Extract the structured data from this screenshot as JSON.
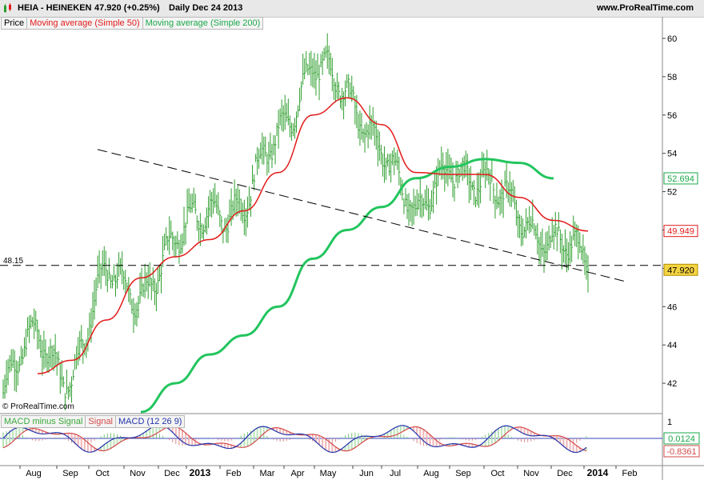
{
  "header": {
    "symbol": "HEIA - HEINEKEN",
    "last": "47.920 (+0.25%)",
    "period": "Daily  Dec 24 2013",
    "site": "www.ProRealTime.com"
  },
  "legend": {
    "price": "Price",
    "sma50": "Moving average (Simple 50)",
    "sma200": "Moving average (Simple 200)"
  },
  "macd_legend": {
    "hist": "MACD minus Signal",
    "signal": "Signal",
    "macd": "MACD (12 26 9)"
  },
  "copyright": "© ProRealTime.com",
  "colors": {
    "price_bars": "#2e9e2e",
    "sma50": "#e31a1a",
    "sma200": "#22c55e",
    "macd": "#2233aa",
    "signal": "#d44a4a",
    "hist": "#8ec98e",
    "label_last": "#f5d442",
    "grid": "#c8c8c8"
  },
  "chart_data": {
    "type": "line",
    "y_ticks": [
      42,
      44,
      46,
      48,
      50,
      52,
      54,
      56,
      58,
      60
    ],
    "ylim": [
      40.5,
      60.5
    ],
    "x_ticks": [
      "Aug",
      "Sep",
      "Oct",
      "Nov",
      "Dec",
      "2013",
      "Feb",
      "Mar",
      "Apr",
      "May",
      "Jun",
      "Jul",
      "Aug",
      "Sep",
      "Oct",
      "Nov",
      "Dec",
      "2014",
      "Feb"
    ],
    "x_tick_bold": [
      "2013",
      "2014"
    ],
    "months": [
      "Jul",
      "Aug",
      "Sep",
      "Oct",
      "Nov",
      "Dec",
      "Jan",
      "Feb",
      "Mar",
      "Apr",
      "May",
      "Jun",
      "Jul",
      "Aug",
      "Sep",
      "Oct",
      "Nov",
      "Dec"
    ],
    "price_close": [
      41.5,
      44.5,
      42.5,
      47.5,
      47.0,
      49.0,
      51.5,
      51.0,
      55.0,
      59.0,
      56.5,
      55.0,
      50.0,
      54.0,
      52.0,
      51.0,
      49.5,
      47.92
    ],
    "sma50": [
      null,
      42.5,
      43.2,
      45.3,
      47.5,
      48.6,
      49.5,
      51.0,
      53.0,
      56.0,
      56.9,
      55.5,
      53.0,
      52.9,
      52.9,
      51.7,
      50.5,
      49.949
    ],
    "sma200": [
      null,
      null,
      null,
      null,
      40.5,
      42.0,
      43.5,
      44.5,
      46.0,
      48.5,
      50.0,
      51.2,
      52.7,
      53.3,
      53.7,
      53.5,
      52.694,
      null
    ],
    "levels": {
      "support": 48.15,
      "support_label": "48.15",
      "sma200_last": "52.694",
      "sma50_last": "49.949",
      "price_last": "47.920"
    },
    "trendline": {
      "from": [
        "Sep",
        54.2
      ],
      "to": [
        "Jan",
        49.5
      ]
    },
    "macd_panel": {
      "y_ticks": [
        "1"
      ],
      "zero_value": "0.0124",
      "signal_value": "-0.8361"
    }
  }
}
